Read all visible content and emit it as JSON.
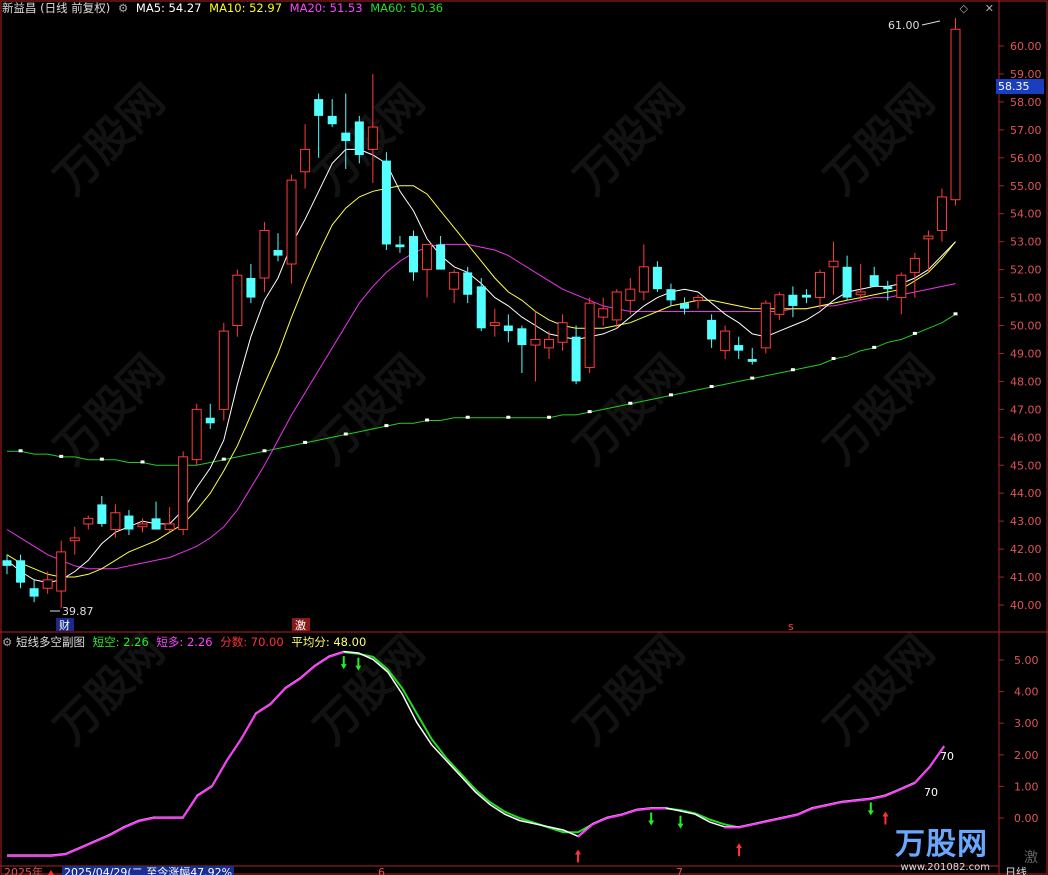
{
  "header": {
    "stock": "新益昌 (日线 前复权)",
    "ma": [
      {
        "label": "MA5: 54.27",
        "color": "#ffffff"
      },
      {
        "label": "MA10: 52.97",
        "color": "#ffff00"
      },
      {
        "label": "MA20: 51.53",
        "color": "#ff44ff"
      },
      {
        "label": "MA60: 50.36",
        "color": "#22dd22"
      }
    ]
  },
  "sub_header": {
    "title": "短线多空副图",
    "items": [
      {
        "label": "短空: 2.26",
        "color": "#22ee22"
      },
      {
        "label": "短多: 2.26",
        "color": "#ff44ff"
      },
      {
        "label": "分数: 70.00",
        "color": "#ff3333"
      },
      {
        "label": "平均分: 48.00",
        "color": "#ffff66"
      }
    ]
  },
  "annotations": {
    "high_label": "61.00",
    "low_label": "39.87",
    "current_price": "58.35",
    "score_top": "70",
    "score_bottom": "70",
    "marker_cai": "财",
    "marker_ji": "激",
    "marker_s": "s",
    "date_start": "2025年",
    "date_range": "2025/04/29(二 至今涨幅47.92%",
    "month_6": "6",
    "month_7": "7",
    "period": "日线",
    "ji_right": "激"
  },
  "watermark": {
    "logo": "万股网",
    "site": "www.201082.com"
  },
  "chart_data": {
    "type": "candlestick",
    "price_axis": {
      "ticks": [
        "40.00",
        "41.00",
        "42.00",
        "43.00",
        "44.00",
        "45.00",
        "46.00",
        "47.00",
        "48.00",
        "49.00",
        "50.00",
        "51.00",
        "52.00",
        "53.00",
        "54.00",
        "55.00",
        "56.00",
        "57.00",
        "58.00",
        "59.00",
        "60.00"
      ],
      "range": [
        39.5,
        61.5
      ]
    },
    "osc_axis": {
      "ticks": [
        "0.00",
        "1.00",
        "2.00",
        "3.00",
        "4.00",
        "5.00"
      ],
      "range": [
        -1.3,
        5.5
      ]
    },
    "candles": [
      {
        "o": 41.6,
        "h": 41.8,
        "l": 41.1,
        "c": 41.4
      },
      {
        "o": 41.6,
        "h": 41.8,
        "l": 40.6,
        "c": 40.8
      },
      {
        "o": 40.6,
        "h": 40.9,
        "l": 40.1,
        "c": 40.3
      },
      {
        "o": 40.6,
        "h": 41.2,
        "l": 40.4,
        "c": 40.9
      },
      {
        "o": 40.5,
        "h": 42.3,
        "l": 39.9,
        "c": 41.9
      },
      {
        "o": 42.3,
        "h": 42.8,
        "l": 41.8,
        "c": 42.4
      },
      {
        "o": 42.9,
        "h": 43.2,
        "l": 42.7,
        "c": 43.1
      },
      {
        "o": 43.6,
        "h": 43.9,
        "l": 42.8,
        "c": 42.9
      },
      {
        "o": 42.7,
        "h": 43.6,
        "l": 42.4,
        "c": 43.3
      },
      {
        "o": 43.2,
        "h": 43.4,
        "l": 42.5,
        "c": 42.7
      },
      {
        "o": 42.8,
        "h": 43.1,
        "l": 42.6,
        "c": 42.9
      },
      {
        "o": 43.1,
        "h": 43.7,
        "l": 42.7,
        "c": 42.7
      },
      {
        "o": 42.7,
        "h": 43.5,
        "l": 42.6,
        "c": 42.9
      },
      {
        "o": 42.7,
        "h": 45.5,
        "l": 42.5,
        "c": 45.3
      },
      {
        "o": 45.2,
        "h": 47.2,
        "l": 45.0,
        "c": 47.0
      },
      {
        "o": 46.7,
        "h": 47.2,
        "l": 46.3,
        "c": 46.5
      },
      {
        "o": 47.0,
        "h": 50.1,
        "l": 46.6,
        "c": 49.8
      },
      {
        "o": 50.0,
        "h": 52.0,
        "l": 49.6,
        "c": 51.8
      },
      {
        "o": 51.7,
        "h": 52.2,
        "l": 50.8,
        "c": 51.0
      },
      {
        "o": 51.7,
        "h": 53.7,
        "l": 51.2,
        "c": 53.4
      },
      {
        "o": 52.7,
        "h": 53.3,
        "l": 52.3,
        "c": 52.5
      },
      {
        "o": 52.2,
        "h": 55.4,
        "l": 51.5,
        "c": 55.2
      },
      {
        "o": 55.5,
        "h": 57.2,
        "l": 54.9,
        "c": 56.3
      },
      {
        "o": 58.1,
        "h": 58.3,
        "l": 56.0,
        "c": 57.5
      },
      {
        "o": 57.5,
        "h": 58.1,
        "l": 57.1,
        "c": 57.2
      },
      {
        "o": 56.9,
        "h": 58.3,
        "l": 55.6,
        "c": 56.6
      },
      {
        "o": 57.3,
        "h": 57.5,
        "l": 55.8,
        "c": 56.1
      },
      {
        "o": 56.3,
        "h": 59.0,
        "l": 55.1,
        "c": 57.1
      },
      {
        "o": 55.9,
        "h": 56.2,
        "l": 52.7,
        "c": 52.9
      },
      {
        "o": 52.9,
        "h": 53.2,
        "l": 52.6,
        "c": 52.8
      },
      {
        "o": 53.2,
        "h": 53.4,
        "l": 51.6,
        "c": 51.9
      },
      {
        "o": 52.0,
        "h": 52.9,
        "l": 51.0,
        "c": 52.9
      },
      {
        "o": 52.9,
        "h": 53.2,
        "l": 52.0,
        "c": 52.0
      },
      {
        "o": 51.3,
        "h": 52.0,
        "l": 50.8,
        "c": 51.9
      },
      {
        "o": 51.9,
        "h": 52.1,
        "l": 50.8,
        "c": 51.1
      },
      {
        "o": 51.4,
        "h": 51.7,
        "l": 49.8,
        "c": 49.9
      },
      {
        "o": 50.0,
        "h": 50.6,
        "l": 49.6,
        "c": 50.1
      },
      {
        "o": 50.0,
        "h": 50.4,
        "l": 49.4,
        "c": 49.8
      },
      {
        "o": 49.9,
        "h": 50.0,
        "l": 48.3,
        "c": 49.3
      },
      {
        "o": 49.3,
        "h": 50.5,
        "l": 48.0,
        "c": 49.5
      },
      {
        "o": 49.2,
        "h": 49.8,
        "l": 48.8,
        "c": 49.5
      },
      {
        "o": 49.4,
        "h": 50.4,
        "l": 49.1,
        "c": 50.1
      },
      {
        "o": 49.6,
        "h": 50.0,
        "l": 47.9,
        "c": 48.0
      },
      {
        "o": 48.5,
        "h": 51.0,
        "l": 48.3,
        "c": 50.8
      },
      {
        "o": 50.3,
        "h": 51.0,
        "l": 50.0,
        "c": 50.6
      },
      {
        "o": 50.2,
        "h": 51.3,
        "l": 49.9,
        "c": 51.2
      },
      {
        "o": 50.9,
        "h": 51.7,
        "l": 50.4,
        "c": 51.3
      },
      {
        "o": 51.2,
        "h": 52.9,
        "l": 50.9,
        "c": 52.1
      },
      {
        "o": 52.1,
        "h": 52.3,
        "l": 51.2,
        "c": 51.3
      },
      {
        "o": 51.3,
        "h": 51.5,
        "l": 50.7,
        "c": 50.9
      },
      {
        "o": 50.8,
        "h": 51.0,
        "l": 50.4,
        "c": 50.6
      },
      {
        "o": 50.9,
        "h": 51.1,
        "l": 50.6,
        "c": 51.0
      },
      {
        "o": 50.2,
        "h": 50.4,
        "l": 49.2,
        "c": 49.5
      },
      {
        "o": 49.1,
        "h": 50.0,
        "l": 48.8,
        "c": 49.8
      },
      {
        "o": 49.3,
        "h": 49.6,
        "l": 48.8,
        "c": 49.1
      },
      {
        "o": 48.8,
        "h": 49.2,
        "l": 48.6,
        "c": 48.7
      },
      {
        "o": 49.2,
        "h": 50.9,
        "l": 49.0,
        "c": 50.8
      },
      {
        "o": 50.4,
        "h": 51.2,
        "l": 50.2,
        "c": 51.1
      },
      {
        "o": 51.1,
        "h": 51.4,
        "l": 50.3,
        "c": 50.7
      },
      {
        "o": 51.1,
        "h": 51.3,
        "l": 50.8,
        "c": 51.0
      },
      {
        "o": 51.0,
        "h": 52.0,
        "l": 50.6,
        "c": 51.9
      },
      {
        "o": 52.1,
        "h": 53.0,
        "l": 51.1,
        "c": 52.3
      },
      {
        "o": 52.1,
        "h": 52.5,
        "l": 50.9,
        "c": 51.0
      },
      {
        "o": 51.1,
        "h": 52.2,
        "l": 50.9,
        "c": 51.2
      },
      {
        "o": 51.8,
        "h": 52.1,
        "l": 51.4,
        "c": 51.4
      },
      {
        "o": 51.4,
        "h": 51.6,
        "l": 50.9,
        "c": 51.3
      },
      {
        "o": 51.0,
        "h": 51.9,
        "l": 50.4,
        "c": 51.8
      },
      {
        "o": 51.9,
        "h": 52.6,
        "l": 51.0,
        "c": 52.4
      },
      {
        "o": 53.1,
        "h": 53.4,
        "l": 51.9,
        "c": 53.2
      },
      {
        "o": 53.4,
        "h": 54.9,
        "l": 53.0,
        "c": 54.6
      },
      {
        "o": 54.5,
        "h": 61.0,
        "l": 54.3,
        "c": 60.6
      }
    ],
    "ma5": [
      41.6,
      41.2,
      40.9,
      40.8,
      40.9,
      41.2,
      41.6,
      42.2,
      42.6,
      42.8,
      43.0,
      42.9,
      42.9,
      43.4,
      44.2,
      44.9,
      45.9,
      47.9,
      49.6,
      50.9,
      51.7,
      52.9,
      53.8,
      54.8,
      55.8,
      56.3,
      56.3,
      56.1,
      55.8,
      54.8,
      54.1,
      53.1,
      52.5,
      52.1,
      51.9,
      51.5,
      51.0,
      50.7,
      50.3,
      50.0,
      49.7,
      49.6,
      49.5,
      49.6,
      49.7,
      49.9,
      50.3,
      50.7,
      51.0,
      51.2,
      51.3,
      51.2,
      50.8,
      50.4,
      50.1,
      49.7,
      49.6,
      49.8,
      50.0,
      50.2,
      50.5,
      50.9,
      51.2,
      51.3,
      51.4,
      51.4,
      51.5,
      51.7,
      52.0,
      52.5,
      53.0
    ],
    "ma10": [
      41.8,
      41.5,
      41.3,
      41.1,
      41.0,
      41.0,
      41.1,
      41.3,
      41.6,
      41.9,
      42.1,
      42.3,
      42.6,
      42.9,
      43.4,
      44.0,
      44.8,
      45.7,
      46.8,
      47.9,
      49.0,
      50.3,
      51.5,
      52.6,
      53.6,
      54.2,
      54.6,
      54.8,
      54.9,
      55.0,
      55.0,
      54.7,
      54.1,
      53.5,
      52.9,
      52.3,
      51.7,
      51.2,
      50.9,
      50.5,
      50.2,
      50.0,
      49.9,
      49.9,
      49.9,
      50.0,
      50.1,
      50.3,
      50.5,
      50.7,
      50.8,
      50.9,
      50.9,
      50.8,
      50.7,
      50.6,
      50.6,
      50.6,
      50.6,
      50.6,
      50.7,
      50.8,
      50.9,
      51.0,
      51.1,
      51.2,
      51.3,
      51.6,
      51.9,
      52.4,
      53.0
    ],
    "ma20": [
      42.7,
      42.4,
      42.1,
      41.8,
      41.6,
      41.4,
      41.3,
      41.3,
      41.3,
      41.4,
      41.5,
      41.6,
      41.7,
      41.9,
      42.1,
      42.4,
      42.8,
      43.4,
      44.2,
      45.0,
      45.9,
      46.8,
      47.6,
      48.4,
      49.2,
      50.0,
      50.8,
      51.4,
      51.9,
      52.3,
      52.6,
      52.8,
      52.9,
      52.9,
      52.9,
      52.8,
      52.7,
      52.5,
      52.2,
      51.9,
      51.6,
      51.3,
      51.1,
      50.9,
      50.7,
      50.6,
      50.5,
      50.5,
      50.5,
      50.5,
      50.5,
      50.5,
      50.5,
      50.5,
      50.5,
      50.5,
      50.5,
      50.5,
      50.6,
      50.6,
      50.7,
      50.7,
      50.8,
      50.9,
      51.0,
      51.0,
      51.1,
      51.2,
      51.3,
      51.4,
      51.5
    ],
    "ma60": [
      45.5,
      45.5,
      45.4,
      45.4,
      45.3,
      45.3,
      45.2,
      45.2,
      45.2,
      45.1,
      45.1,
      45.0,
      45.0,
      45.0,
      45.0,
      45.1,
      45.2,
      45.3,
      45.4,
      45.5,
      45.6,
      45.7,
      45.8,
      45.9,
      46.0,
      46.1,
      46.2,
      46.3,
      46.4,
      46.5,
      46.5,
      46.6,
      46.6,
      46.7,
      46.7,
      46.7,
      46.7,
      46.7,
      46.7,
      46.7,
      46.7,
      46.8,
      46.8,
      46.9,
      47.0,
      47.1,
      47.2,
      47.3,
      47.4,
      47.5,
      47.6,
      47.7,
      47.8,
      47.9,
      48.0,
      48.1,
      48.2,
      48.3,
      48.4,
      48.5,
      48.6,
      48.8,
      48.9,
      49.1,
      49.2,
      49.4,
      49.5,
      49.7,
      49.9,
      50.1,
      50.4
    ],
    "short_long": [
      -1.2,
      -1.2,
      -1.2,
      -1.2,
      -1.15,
      -0.95,
      -0.75,
      -0.55,
      -0.3,
      -0.1,
      0.0,
      0.0,
      0.0,
      0.7,
      1.0,
      1.8,
      2.5,
      3.3,
      3.6,
      4.1,
      4.4,
      4.8,
      5.1,
      5.25,
      5.2,
      5.0,
      4.6,
      3.9,
      3.0,
      2.3,
      1.8,
      1.3,
      0.8,
      0.4,
      0.1,
      -0.1,
      -0.2,
      -0.3,
      -0.4,
      -0.6,
      -0.2,
      0.0,
      0.1,
      0.25,
      0.3,
      0.3,
      0.2,
      0.1,
      -0.15,
      -0.3,
      -0.3,
      -0.2,
      -0.1,
      0.0,
      0.1,
      0.3,
      0.4,
      0.5,
      0.55,
      0.6,
      0.7,
      0.9,
      1.1,
      1.6,
      2.26
    ],
    "short_short": [
      -1.2,
      -1.2,
      -1.2,
      -1.2,
      -1.15,
      -0.95,
      -0.75,
      -0.55,
      -0.3,
      -0.1,
      0.0,
      0.0,
      0.0,
      0.7,
      1.0,
      1.8,
      2.5,
      3.3,
      3.6,
      4.1,
      4.4,
      4.8,
      5.1,
      5.25,
      5.2,
      5.1,
      4.7,
      4.1,
      3.3,
      2.5,
      1.9,
      1.4,
      0.9,
      0.5,
      0.2,
      0.0,
      -0.15,
      -0.3,
      -0.45,
      -0.45,
      -0.2,
      0.0,
      0.1,
      0.25,
      0.3,
      0.3,
      0.25,
      0.15,
      -0.05,
      -0.2,
      -0.3,
      -0.2,
      -0.1,
      0.0,
      0.1,
      0.3,
      0.4,
      0.5,
      0.55,
      0.6,
      0.7,
      0.9,
      1.1,
      1.6,
      2.26
    ]
  }
}
